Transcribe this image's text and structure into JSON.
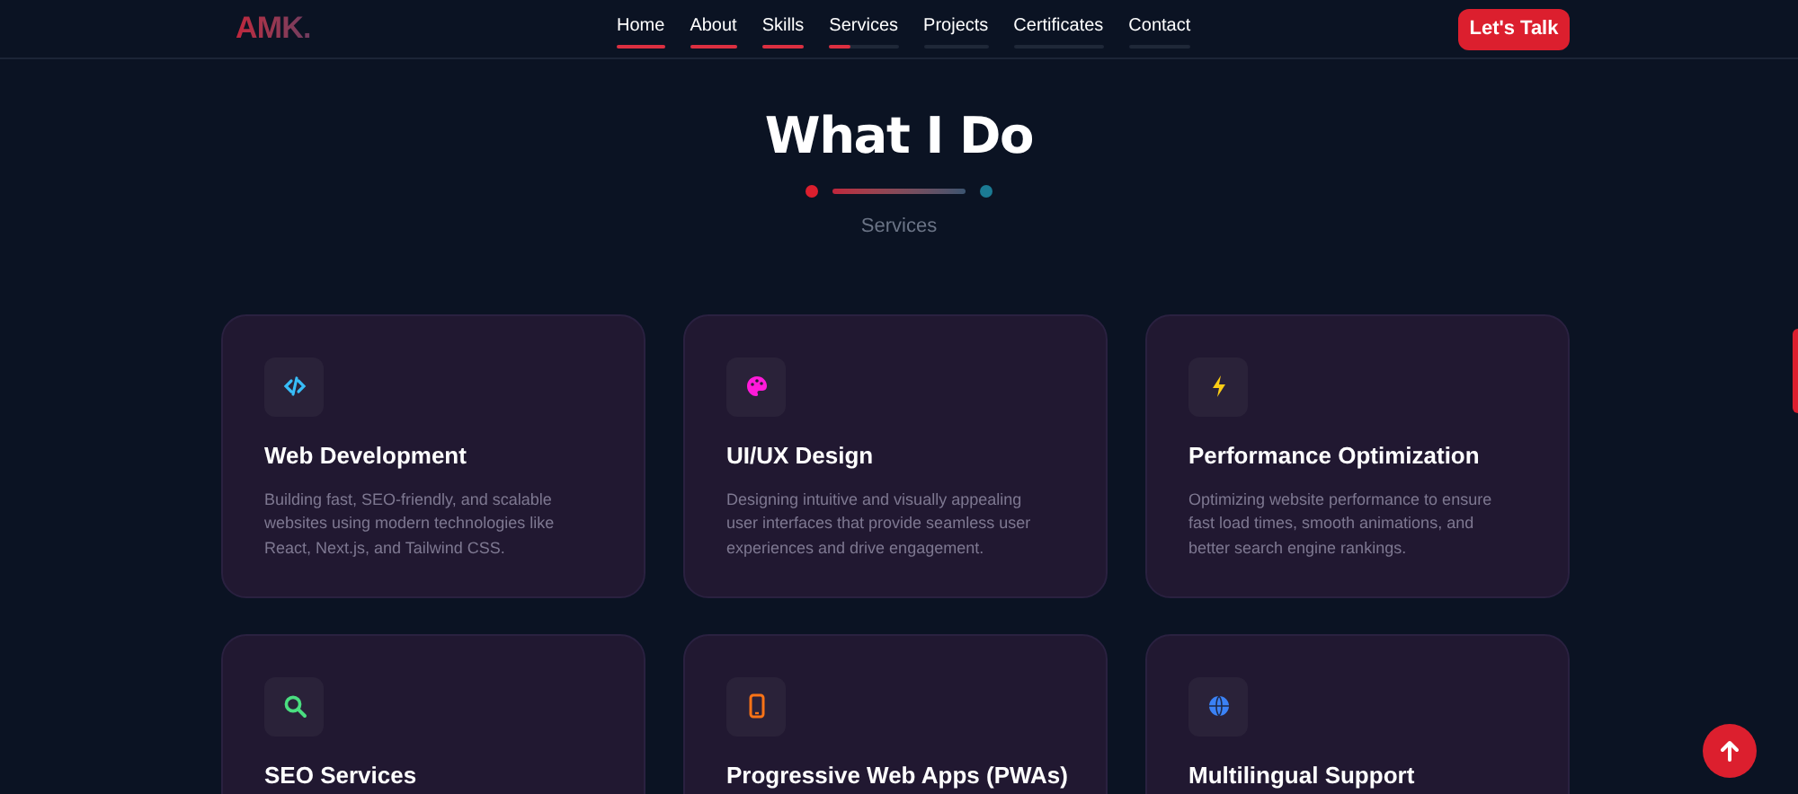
{
  "header": {
    "logo": "AMK.",
    "nav": [
      {
        "label": "Home",
        "level": 1
      },
      {
        "label": "About",
        "level": 1
      },
      {
        "label": "Skills",
        "level": 1
      },
      {
        "label": "Services",
        "level": 0.3
      },
      {
        "label": "Projects",
        "level": 0
      },
      {
        "label": "Certificates",
        "level": 0
      },
      {
        "label": "Contact",
        "level": 0
      }
    ],
    "cta": "Let's Talk"
  },
  "section": {
    "title": "What I Do",
    "subtitle": "Services"
  },
  "services": [
    {
      "kind": "code",
      "color": "#38bdf8",
      "title": "Web Development",
      "description": "Building fast, SEO-friendly, and scalable websites using modern technologies like React, Next.js, and Tailwind CSS."
    },
    {
      "kind": "palette",
      "color": "#ff1ad9",
      "title": "UI/UX Design",
      "description": "Designing intuitive and visually appealing user interfaces that provide seamless user experiences and drive engagement."
    },
    {
      "kind": "bolt",
      "color": "#facc15",
      "title": "Performance Optimization",
      "description": "Optimizing website performance to ensure fast load times, smooth animations, and better search engine rankings."
    },
    {
      "kind": "search",
      "color": "#4ade80",
      "title": "SEO Services"
    },
    {
      "kind": "phone",
      "color": "#f97316",
      "title": "Progressive Web Apps (PWAs)"
    },
    {
      "kind": "globe",
      "color": "#3b82f6",
      "title": "Multilingual Support"
    }
  ]
}
